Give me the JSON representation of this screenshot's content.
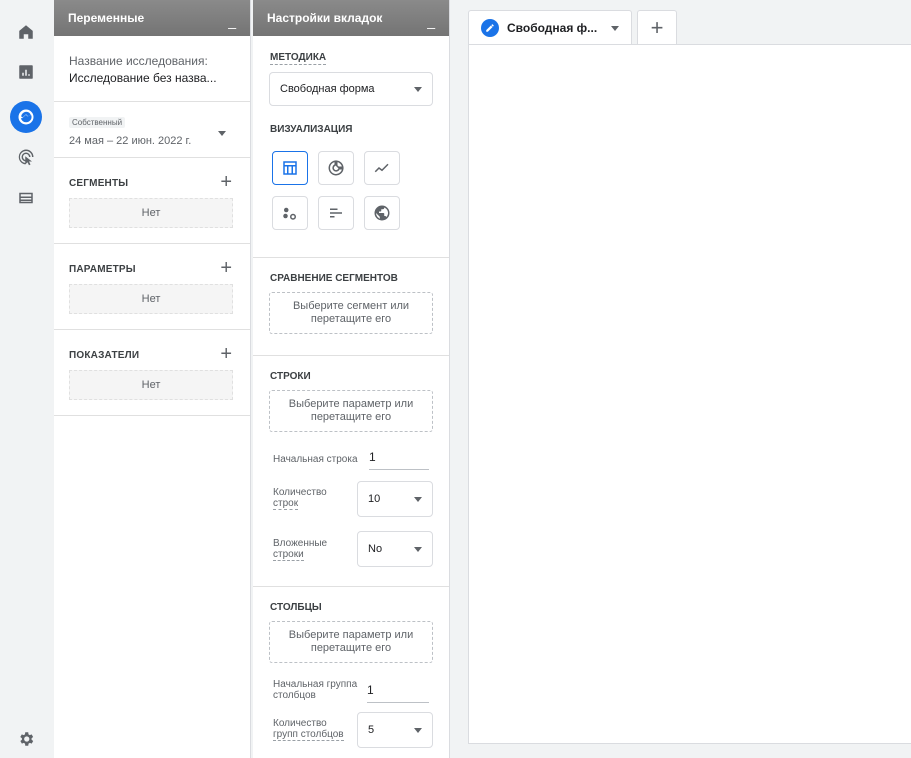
{
  "rail": {
    "items": [
      "home-icon",
      "reports-icon",
      "explore-icon",
      "advertising-icon",
      "configure-icon"
    ],
    "settings": "settings-icon",
    "accent": "#1a73e8"
  },
  "variables": {
    "title": "Переменные",
    "minimize": "_",
    "study_label": "Название исследования:",
    "study_name": "Исследование без назва...",
    "date_label": "Собственный",
    "date_range": "24 мая – 22 июн. 2022 г.",
    "segments": {
      "title": "СЕГМЕНТЫ",
      "add": "+",
      "empty": "Нет"
    },
    "dimensions": {
      "title": "ПАРАМЕТРЫ",
      "add": "+",
      "empty": "Нет"
    },
    "metrics": {
      "title": "ПОКАЗАТЕЛИ",
      "add": "+",
      "empty": "Нет"
    }
  },
  "tab_settings": {
    "title": "Настройки вкладок",
    "minimize": "_",
    "technique_title": "МЕТОДИКА",
    "technique_value": "Свободная форма",
    "viz_title": "ВИЗУАЛИЗАЦИЯ",
    "viz_buttons": [
      "table-icon",
      "donut-chart-icon",
      "line-chart-icon",
      "scatter-plot-icon",
      "bar-chart-icon",
      "geo-map-icon"
    ],
    "segment_compare_title": "СРАВНЕНИЕ СЕГМЕНТОВ",
    "segment_drop": "Выберите сегмент или перетащите его",
    "rows_title": "СТРОКИ",
    "rows_drop": "Выберите параметр или перетащите его",
    "start_row_label": "Начальная строка",
    "start_row_value": "1",
    "show_rows_label_1": "Количество",
    "show_rows_label_2": "строк",
    "show_rows_value": "10",
    "nested_rows_label_1": "Вложенные",
    "nested_rows_label_2": "строки",
    "nested_rows_value": "No",
    "columns_title": "СТОЛБЦЫ",
    "columns_drop": "Выберите параметр или перетащите его",
    "start_col_label_1": "Начальная группа",
    "start_col_label_2": "столбцов",
    "start_col_value": "1",
    "col_groups_label_1": "Количество",
    "col_groups_label_2": "групп столбцов",
    "col_groups_value": "5"
  },
  "canvas": {
    "tab_label": "Свободная ф...",
    "add_tab": "+"
  }
}
